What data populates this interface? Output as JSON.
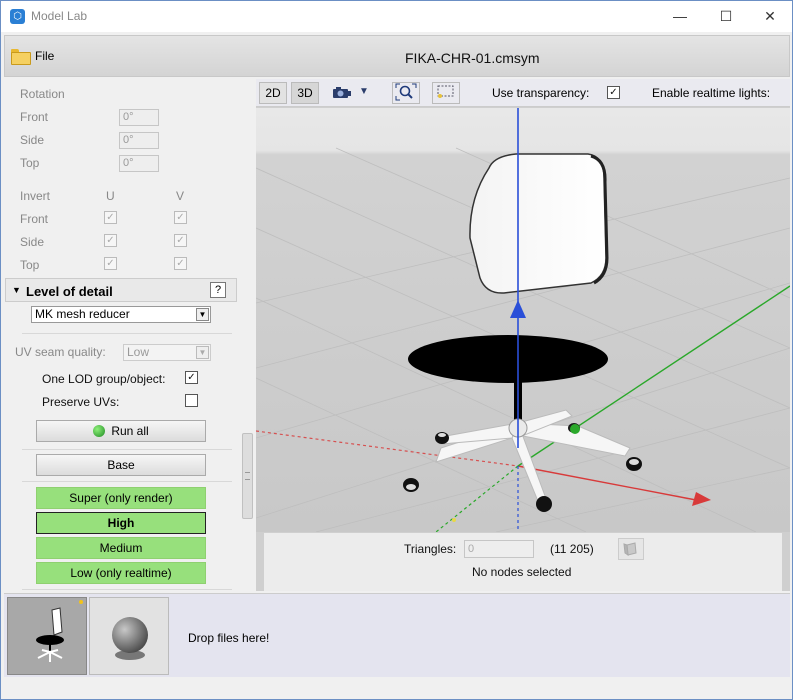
{
  "window": {
    "app_title": "Model Lab",
    "app_icon": "hexagon-logo-icon",
    "minimize": "—",
    "maximize": "☐",
    "close": "✕"
  },
  "toolbar": {
    "file_label": "File",
    "document_title": "FIKA-CHR-01.cmsym"
  },
  "left_panel": {
    "rotation": {
      "title": "Rotation",
      "rows": [
        {
          "label": "Front",
          "value": "0°"
        },
        {
          "label": "Side",
          "value": "0°"
        },
        {
          "label": "Top",
          "value": "0°"
        }
      ]
    },
    "invert": {
      "title": "Invert",
      "col_u": "U",
      "col_v": "V",
      "check": "✓",
      "rows": [
        {
          "label": "Front",
          "u": true,
          "v": true
        },
        {
          "label": "Side",
          "u": true,
          "v": true
        },
        {
          "label": "Top",
          "u": true,
          "v": true
        }
      ]
    },
    "lod": {
      "title": "Level of detail",
      "expand_glyph": "▼",
      "help": "?",
      "reducer": "MK mesh reducer",
      "uv_seam_label": "UV seam quality:",
      "uv_seam_value": "Low",
      "one_lod_label": "One LOD group/object:",
      "one_lod_checked": true,
      "preserve_uvs_label": "Preserve UVs:",
      "preserve_uvs_checked": false,
      "run_all": "Run all",
      "base": "Base",
      "levels": [
        {
          "label": "Super (only render)",
          "selected": false
        },
        {
          "label": "High",
          "selected": true
        },
        {
          "label": "Medium",
          "selected": false
        },
        {
          "label": "Low (only realtime)",
          "selected": false
        }
      ]
    }
  },
  "viewport": {
    "btn_2d": "2D",
    "btn_3d": "3D",
    "camera_icon": "camera-icon",
    "dropdown_glyph": "▼",
    "use_transparency_label": "Use transparency:",
    "use_transparency_checked": true,
    "realtime_lights_label": "Enable realtime lights:",
    "info": {
      "triangles_label": "Triangles:",
      "triangles_value": "0",
      "triangles_total": "(11 205)",
      "selection_status": "No nodes selected"
    }
  },
  "bottom": {
    "drop_text": "Drop files here!",
    "thumbnails": [
      {
        "name": "chair-thumbnail",
        "selected": true
      },
      {
        "name": "sphere-material-thumbnail",
        "selected": false
      }
    ]
  },
  "colors": {
    "lod_green": "#97e07c",
    "axis_blue": "#2a4fd8",
    "axis_green": "#2aa82a",
    "axis_red": "#d83a3a"
  }
}
